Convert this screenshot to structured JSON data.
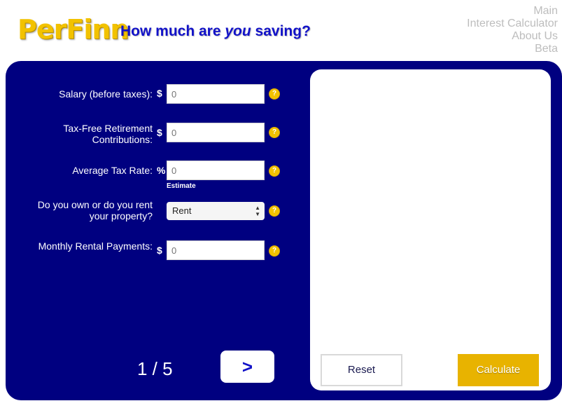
{
  "header": {
    "logo_text": "PerFinn",
    "tagline_pre": "How much are ",
    "tagline_em": "you",
    "tagline_post": " saving?"
  },
  "nav": {
    "items": [
      "Main",
      "Interest Calculator",
      "About Us",
      "Beta"
    ]
  },
  "form": {
    "salary": {
      "label": "Salary (before taxes):",
      "symbol": "$",
      "placeholder": "0",
      "help": "?"
    },
    "retirement": {
      "label": "Tax-Free Retirement Contributions:",
      "symbol": "$",
      "placeholder": "0",
      "help": "?"
    },
    "tax_rate": {
      "label": "Average Tax Rate:",
      "symbol": "%",
      "placeholder": "0",
      "hint": "Estimate",
      "help": "?"
    },
    "property": {
      "label": "Do you own or do you rent your property?",
      "selected": "Rent",
      "help": "?"
    },
    "rental": {
      "label": "Monthly Rental Payments:",
      "symbol": "$",
      "placeholder": "0",
      "help": "?"
    }
  },
  "pager": {
    "step": "1 / 5",
    "next_label": ">"
  },
  "actions": {
    "reset_label": "Reset",
    "calculate_label": "Calculate"
  },
  "colors": {
    "panel": "#000080",
    "accent": "#e8b300",
    "brand_text": "#1212c8"
  }
}
